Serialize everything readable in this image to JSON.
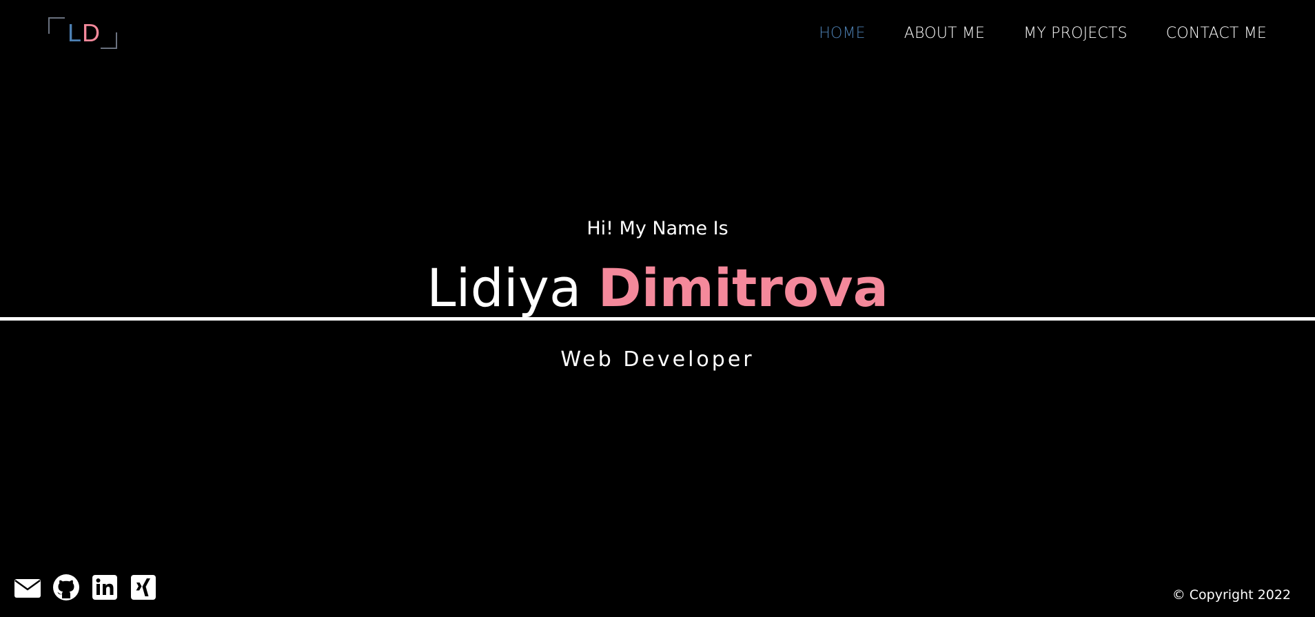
{
  "logo": {
    "letter1": "L",
    "letter2": "D",
    "colors": {
      "letter1": "#4d80b3",
      "letter2": "#f4899b"
    }
  },
  "nav": {
    "items": [
      {
        "label": "HOME",
        "active": true
      },
      {
        "label": "ABOUT ME",
        "active": false
      },
      {
        "label": "MY PROJECTS",
        "active": false
      },
      {
        "label": "CONTACT ME",
        "active": false
      }
    ],
    "active_color": "#4d80b3"
  },
  "hero": {
    "greeting": "Hi! My Name Is",
    "first_name": "Lidiya",
    "last_name": "Dimitrova",
    "role": "Web Developer",
    "accent_color": "#f4899b"
  },
  "social": {
    "icons": [
      "envelope-icon",
      "github-icon",
      "linkedin-icon",
      "xing-icon"
    ]
  },
  "footer": {
    "copyright": "© Copyright 2022"
  }
}
